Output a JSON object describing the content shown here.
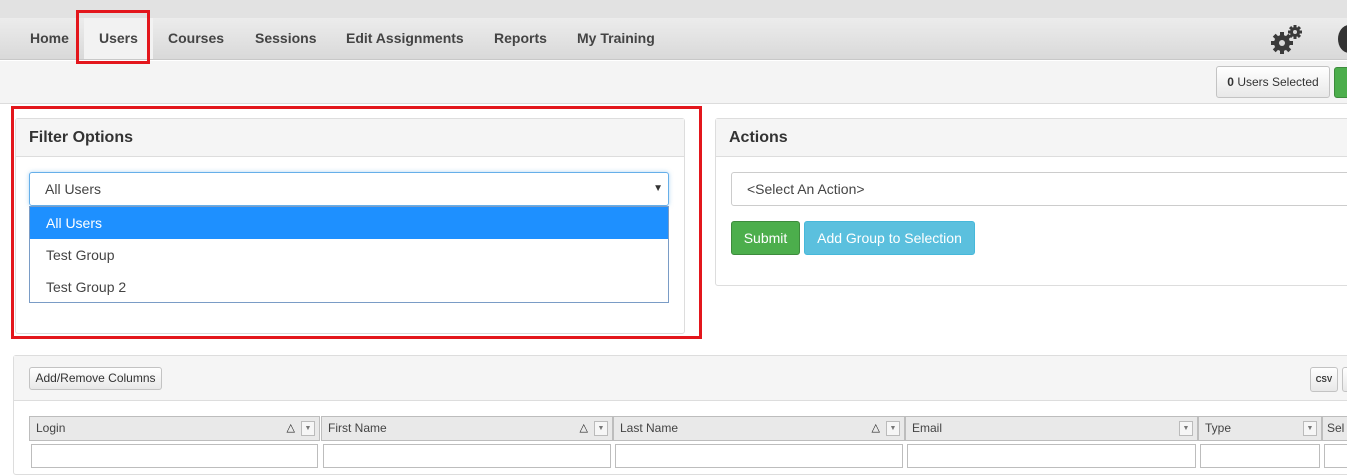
{
  "nav": {
    "items": [
      {
        "label": "Home"
      },
      {
        "label": "Users"
      },
      {
        "label": "Courses"
      },
      {
        "label": "Sessions"
      },
      {
        "label": "Edit Assignments"
      },
      {
        "label": "Reports"
      },
      {
        "label": "My Training"
      }
    ],
    "active": "Users"
  },
  "subbar": {
    "users_selected_count": "0",
    "users_selected_label": "Users Selected"
  },
  "filter": {
    "title": "Filter Options",
    "selected": "All Users",
    "options": [
      "All Users",
      "Test Group",
      "Test Group 2"
    ]
  },
  "actions": {
    "title": "Actions",
    "select_placeholder": "<Select An Action>",
    "submit_label": "Submit",
    "add_group_label": "Add Group to Selection"
  },
  "grid": {
    "add_remove_columns_label": "Add/Remove Columns",
    "csv_label": "CSV",
    "columns": [
      "Login",
      "First Name",
      "Last Name",
      "Email",
      "Type",
      "Sel"
    ]
  },
  "colors": {
    "highlight": "#e3161c",
    "submit": "#4cae4c",
    "info": "#5bc0de",
    "dropdown_selected": "#1e90ff"
  },
  "icons": {
    "settings": "gears-icon",
    "sort": "triangle-up-icon",
    "column_menu": "chevron-down-icon",
    "dropdown": "caret-down-icon"
  }
}
